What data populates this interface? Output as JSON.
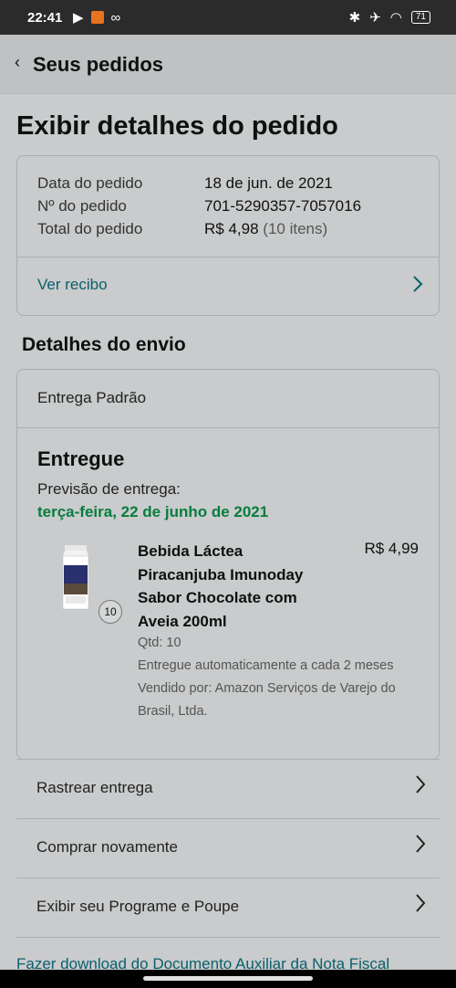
{
  "status_bar": {
    "time": "22:41",
    "battery": "71",
    "icons": [
      "play-store-icon",
      "app-notification-icon",
      "voicemail-icon",
      "bluetooth-icon",
      "airplane-icon",
      "wifi-icon",
      "battery-icon"
    ]
  },
  "header": {
    "back_label": "Seus pedidos"
  },
  "page_title": "Exibir detalhes do pedido",
  "order_info": {
    "date_label": "Data do pedido",
    "date_value": "18 de jun. de 2021",
    "number_label": "Nº do pedido",
    "number_value": "701-5290357-7057016",
    "total_label": "Total do pedido",
    "total_value": "R$ 4,98",
    "total_items": "(10 itens)",
    "receipt_link": "Ver recibo"
  },
  "shipping": {
    "section_title": "Detalhes do envio",
    "method": "Entrega Padrão",
    "status": "Entregue",
    "forecast_label": "Previsão de entrega:",
    "forecast_date": "terça-feira, 22 de junho de 2021",
    "product": {
      "name": "Bebida Láctea Piracanjuba Imunoday Sabor Chocolate com Aveia 200ml",
      "price": "R$ 4,99",
      "qty_badge": "10",
      "qty": "Qtd: 10",
      "subscription": "Entregue automaticamente a cada 2 meses",
      "seller": "Vendido por: Amazon Serviços de Varejo do Brasil, Ltda."
    }
  },
  "actions": [
    {
      "label": "Rastrear entrega"
    },
    {
      "label": "Comprar novamente"
    },
    {
      "label": "Exibir seu Programe e Poupe"
    }
  ],
  "footer_link": "Fazer download do Documento Auxiliar da Nota Fiscal",
  "colors": {
    "link": "#0b5f6c",
    "delivered_green": "#067d3f"
  }
}
